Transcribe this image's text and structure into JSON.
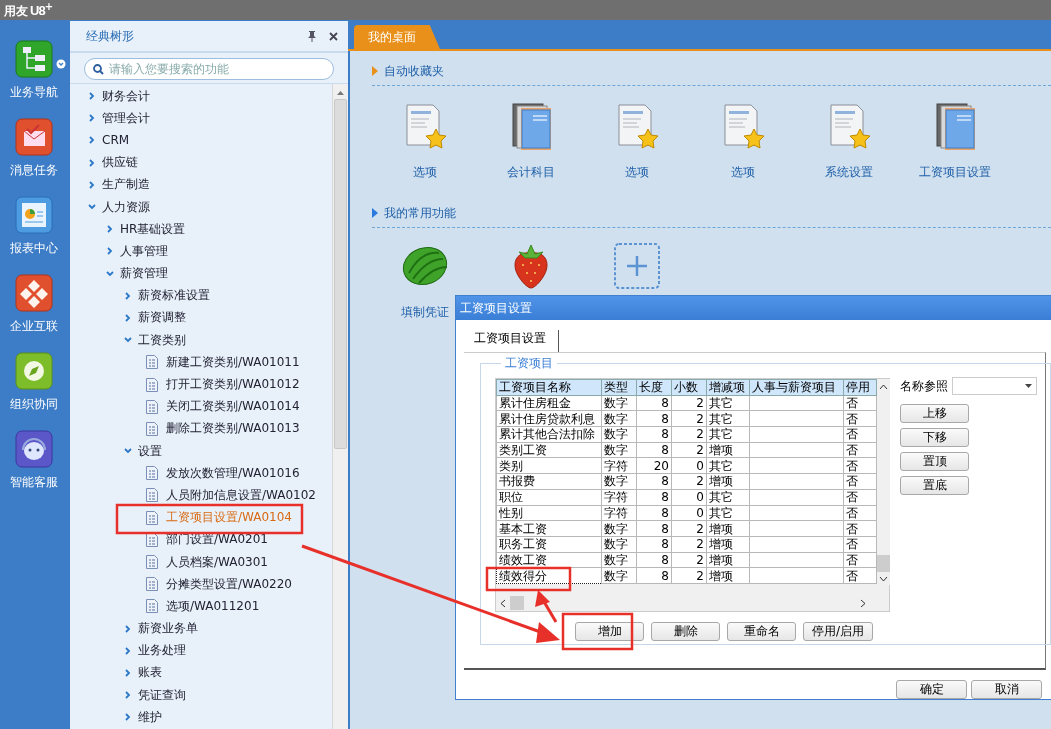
{
  "app_title": {
    "name": "用友",
    "logo": "U8",
    "sup": "+"
  },
  "rail": [
    {
      "label": "业务导航",
      "kind": "nav",
      "menu": true
    },
    {
      "label": "消息任务",
      "kind": "mail",
      "menu": false
    },
    {
      "label": "报表中心",
      "kind": "report",
      "menu": false
    },
    {
      "label": "企业互联",
      "kind": "link",
      "menu": false
    },
    {
      "label": "组织协同",
      "kind": "compass",
      "menu": false
    },
    {
      "label": "智能客服",
      "kind": "service",
      "menu": false
    }
  ],
  "tree": {
    "title": "经典树形",
    "search_placeholder": "请输入您要搜索的功能",
    "items": [
      {
        "label": "财务会计",
        "kind": "folder",
        "expanded": false,
        "selected": false
      },
      {
        "label": "管理会计",
        "kind": "folder",
        "expanded": false,
        "selected": false
      },
      {
        "label": "CRM",
        "kind": "folder",
        "expanded": false,
        "selected": false
      },
      {
        "label": "供应链",
        "kind": "folder",
        "expanded": false,
        "selected": false
      },
      {
        "label": "生产制造",
        "kind": "folder",
        "expanded": false,
        "selected": false
      },
      {
        "label": "人力资源",
        "kind": "folder",
        "expanded": true,
        "selected": false,
        "children": [
          {
            "label": "HR基础设置",
            "kind": "folder",
            "expanded": false,
            "selected": false
          },
          {
            "label": "人事管理",
            "kind": "folder",
            "expanded": false,
            "selected": false
          },
          {
            "label": "薪资管理",
            "kind": "folder",
            "expanded": true,
            "selected": false,
            "children": [
              {
                "label": "薪资标准设置",
                "kind": "folder",
                "expanded": false,
                "selected": false
              },
              {
                "label": "薪资调整",
                "kind": "folder",
                "expanded": false,
                "selected": false
              },
              {
                "label": "工资类别",
                "kind": "folder",
                "expanded": true,
                "selected": false,
                "children": [
                  {
                    "label": "新建工资类别/WA01011",
                    "kind": "leaf",
                    "selected": false
                  },
                  {
                    "label": "打开工资类别/WA01012",
                    "kind": "leaf",
                    "selected": false
                  },
                  {
                    "label": "关闭工资类别/WA01014",
                    "kind": "leaf",
                    "selected": false
                  },
                  {
                    "label": "删除工资类别/WA01013",
                    "kind": "leaf",
                    "selected": false
                  }
                ]
              },
              {
                "label": "设置",
                "kind": "folder",
                "expanded": true,
                "selected": false,
                "children": [
                  {
                    "label": "发放次数管理/WA01016",
                    "kind": "leaf",
                    "selected": false
                  },
                  {
                    "label": "人员附加信息设置/WA0102",
                    "kind": "leaf",
                    "selected": false
                  },
                  {
                    "label": "工资项目设置/WA0104",
                    "kind": "leaf",
                    "selected": true
                  },
                  {
                    "label": "部门设置/WA0201",
                    "kind": "leaf",
                    "selected": false
                  },
                  {
                    "label": "人员档案/WA0301",
                    "kind": "leaf",
                    "selected": false
                  },
                  {
                    "label": "分摊类型设置/WA0220",
                    "kind": "leaf",
                    "selected": false
                  },
                  {
                    "label": "选项/WA011201",
                    "kind": "leaf",
                    "selected": false
                  }
                ]
              },
              {
                "label": "薪资业务单",
                "kind": "folder",
                "expanded": false,
                "selected": false
              },
              {
                "label": "业务处理",
                "kind": "folder",
                "expanded": false,
                "selected": false
              },
              {
                "label": "账表",
                "kind": "folder",
                "expanded": false,
                "selected": false
              },
              {
                "label": "凭证查询",
                "kind": "folder",
                "expanded": false,
                "selected": false
              },
              {
                "label": "维护",
                "kind": "folder",
                "expanded": false,
                "selected": false
              }
            ]
          }
        ]
      }
    ]
  },
  "desktop": {
    "tab": {
      "label": "我的桌面",
      "selected": true
    },
    "favorites": {
      "title": "自动收藏夹",
      "items": [
        {
          "label": "选项",
          "kind": "document"
        },
        {
          "label": "会计科目",
          "kind": "book"
        },
        {
          "label": "选项",
          "kind": "document"
        },
        {
          "label": "选项",
          "kind": "document"
        },
        {
          "label": "系统设置",
          "kind": "document"
        },
        {
          "label": "工资项目设置",
          "kind": "book"
        }
      ]
    },
    "common": {
      "title": "我的常用功能",
      "items": [
        {
          "label": "填制凭证",
          "kind": "melon"
        },
        {
          "kind": "strawberry"
        },
        {
          "kind": "add"
        }
      ]
    }
  },
  "dialog": {
    "title": "工资项目设置",
    "tabs": [
      {
        "label": "工资项目设置",
        "selected": true
      }
    ],
    "group_title": "工资项目",
    "table": {
      "columns": [
        "工资项目名称",
        "类型",
        "长度",
        "小数",
        "增减项",
        "人事与薪资项目",
        "停用"
      ],
      "rows": [
        {
          "cells": [
            "累计住房租金",
            "数字",
            "8",
            "2",
            "其它",
            "",
            "否"
          ],
          "selected": false
        },
        {
          "cells": [
            "累计住房贷款利息",
            "数字",
            "8",
            "2",
            "其它",
            "",
            "否"
          ],
          "selected": false
        },
        {
          "cells": [
            "累计其他合法扣除",
            "数字",
            "8",
            "2",
            "其它",
            "",
            "否"
          ],
          "selected": false
        },
        {
          "cells": [
            "类别工资",
            "数字",
            "8",
            "2",
            "增项",
            "",
            "否"
          ],
          "selected": false
        },
        {
          "cells": [
            "类别",
            "字符",
            "20",
            "0",
            "其它",
            "",
            "否"
          ],
          "selected": false
        },
        {
          "cells": [
            "书报费",
            "数字",
            "8",
            "2",
            "增项",
            "",
            "否"
          ],
          "selected": false
        },
        {
          "cells": [
            "职位",
            "字符",
            "8",
            "0",
            "其它",
            "",
            "否"
          ],
          "selected": false
        },
        {
          "cells": [
            "性别",
            "字符",
            "8",
            "0",
            "其它",
            "",
            "否"
          ],
          "selected": false
        },
        {
          "cells": [
            "基本工资",
            "数字",
            "8",
            "2",
            "增项",
            "",
            "否"
          ],
          "selected": false
        },
        {
          "cells": [
            "职务工资",
            "数字",
            "8",
            "2",
            "增项",
            "",
            "否"
          ],
          "selected": false
        },
        {
          "cells": [
            "绩效工资",
            "数字",
            "8",
            "2",
            "增项",
            "",
            "否"
          ],
          "selected": false
        },
        {
          "cells": [
            "绩效得分",
            "数字",
            "8",
            "2",
            "增项",
            "",
            "否"
          ],
          "selected": true
        }
      ]
    },
    "name_reference": {
      "label": "名称参照"
    },
    "side_buttons": [
      "上移",
      "下移",
      "置顶",
      "置底"
    ],
    "table_buttons": [
      "增加",
      "删除",
      "重命名",
      "停用/启用"
    ],
    "footer_buttons": [
      "确定",
      "取消"
    ]
  }
}
